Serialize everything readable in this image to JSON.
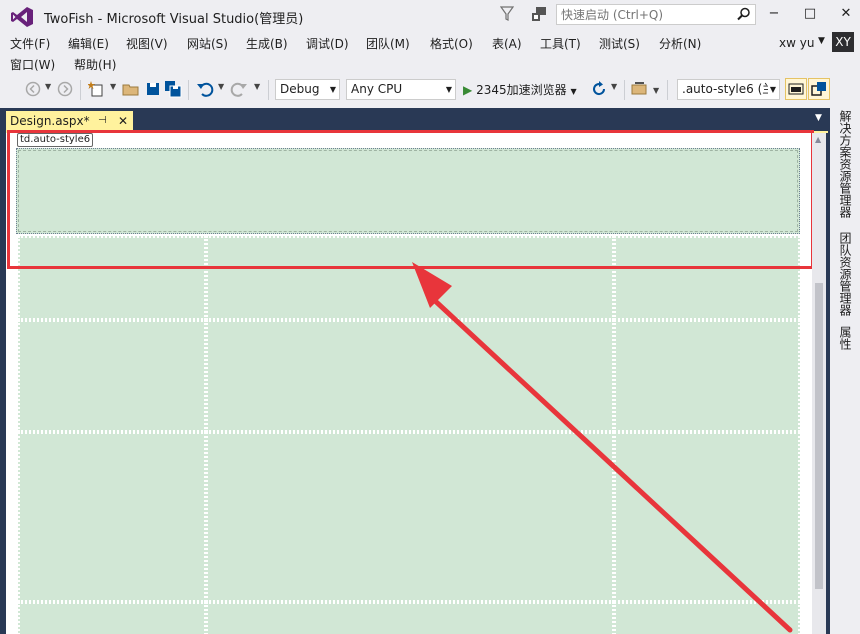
{
  "window": {
    "title": "TwoFish - Microsoft Visual Studio(管理员)",
    "quick_launch_placeholder": "快速启动 (Ctrl+Q)",
    "minimize": "−",
    "maximize": "□",
    "close": "✕"
  },
  "menu": {
    "items": [
      "文件(F)",
      "编辑(E)",
      "视图(V)",
      "网站(S)",
      "生成(B)",
      "调试(D)",
      "团队(M)",
      "格式(O)",
      "表(A)",
      "工具(T)",
      "测试(S)",
      "分析(N)",
      "窗口(W)",
      "帮助(H)"
    ],
    "user_name": "xw yu",
    "user_initials": "XY"
  },
  "toolbar": {
    "configuration": "Debug",
    "platform": "Any CPU",
    "run_label": "2345加速浏览器",
    "style_combo": ".auto-style6 (兰"
  },
  "document": {
    "tab_label": "Design.aspx*",
    "pin_glyph": "⊣",
    "close_glyph": "✕",
    "selected_tag": "td.auto-style6"
  },
  "side_panels": [
    "解决方案资源管理器",
    "团队资源管理器",
    "属性"
  ],
  "colors": {
    "accent_tab": "#fff29d",
    "cell_fill": "#d1e7d5",
    "highlight_red": "#e8353b",
    "well_blue": "#293955"
  }
}
